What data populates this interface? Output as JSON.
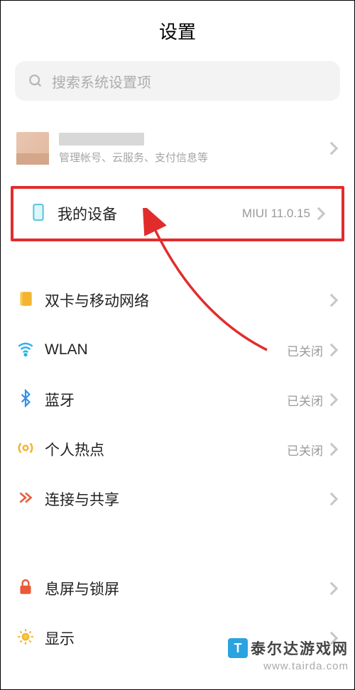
{
  "title": "设置",
  "search": {
    "placeholder": "搜索系统设置项"
  },
  "account": {
    "subtitle": "管理帐号、云服务、支付信息等"
  },
  "highlighted": {
    "label": "我的设备",
    "value": "MIUI 11.0.15"
  },
  "rows": {
    "sim": {
      "label": "双卡与移动网络",
      "value": ""
    },
    "wlan": {
      "label": "WLAN",
      "value": "已关闭"
    },
    "bt": {
      "label": "蓝牙",
      "value": "已关闭"
    },
    "hotspot": {
      "label": "个人热点",
      "value": "已关闭"
    },
    "share": {
      "label": "连接与共享",
      "value": ""
    },
    "lock": {
      "label": "息屏与锁屏",
      "value": ""
    },
    "display": {
      "label": "显示",
      "value": ""
    }
  },
  "watermark": {
    "title": "泰尔达游戏网",
    "url": "www.tairda.com"
  }
}
